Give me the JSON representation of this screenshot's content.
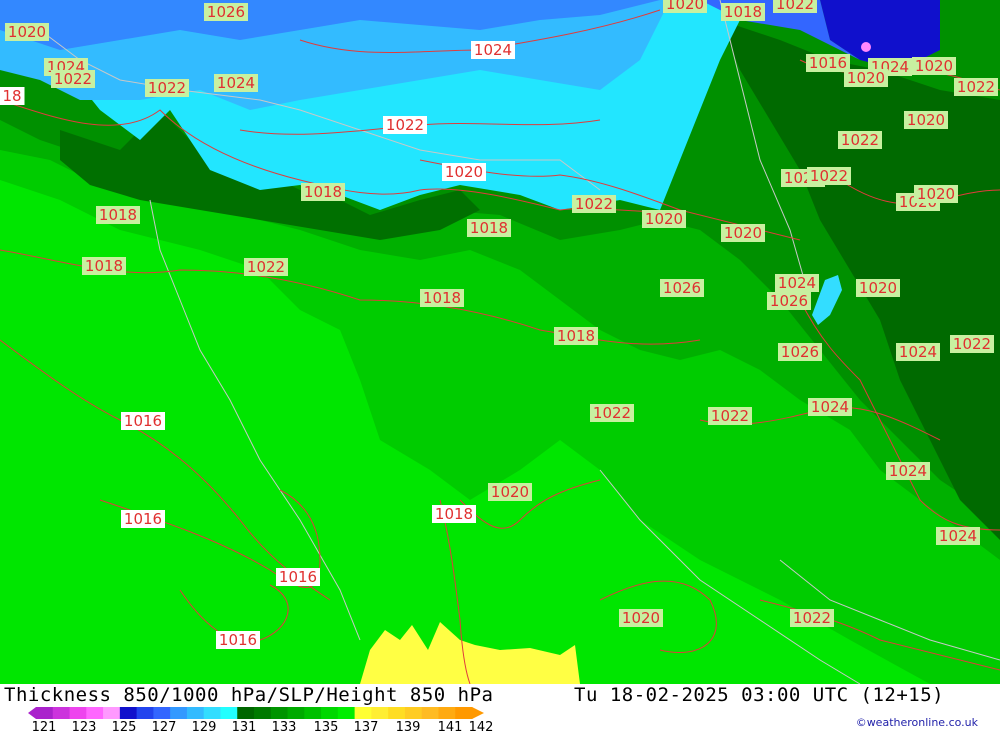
{
  "map": {
    "isobar_labels": [
      {
        "text": "1026",
        "style": "green"
      },
      {
        "text": "1020",
        "style": "green"
      },
      {
        "text": "1024",
        "style": "green"
      },
      {
        "text": "1022",
        "style": "green"
      },
      {
        "text": "18",
        "style": "pink"
      },
      {
        "text": "1022",
        "style": "green"
      },
      {
        "text": "1024",
        "style": "green"
      },
      {
        "text": "1024",
        "style": "pink"
      },
      {
        "text": "1022",
        "style": "pink"
      },
      {
        "text": "1020",
        "style": "pink"
      },
      {
        "text": "1018",
        "style": "green"
      },
      {
        "text": "1022",
        "style": "green"
      },
      {
        "text": "1020",
        "style": "green"
      },
      {
        "text": "1016",
        "style": "green"
      },
      {
        "text": "1024",
        "style": "green"
      },
      {
        "text": "1020",
        "style": "green"
      },
      {
        "text": "1020",
        "style": "green"
      },
      {
        "text": "1022",
        "style": "green"
      },
      {
        "text": "1020",
        "style": "green"
      },
      {
        "text": "1022",
        "style": "green"
      },
      {
        "text": "1020",
        "style": "green"
      },
      {
        "text": "1022",
        "style": "green"
      },
      {
        "text": "1020",
        "style": "green"
      },
      {
        "text": "1020",
        "style": "green"
      },
      {
        "text": "1022",
        "style": "green"
      },
      {
        "text": "1020",
        "style": "green"
      },
      {
        "text": "1018",
        "style": "green"
      },
      {
        "text": "1020",
        "style": "green"
      },
      {
        "text": "1018",
        "style": "green"
      },
      {
        "text": "1018",
        "style": "green"
      },
      {
        "text": "1018",
        "style": "green"
      },
      {
        "text": "1022",
        "style": "green"
      },
      {
        "text": "1026",
        "style": "green"
      },
      {
        "text": "1024",
        "style": "green"
      },
      {
        "text": "1026",
        "style": "green"
      },
      {
        "text": "1018",
        "style": "green"
      },
      {
        "text": "1020",
        "style": "green"
      },
      {
        "text": "1018",
        "style": "green"
      },
      {
        "text": "1026",
        "style": "green"
      },
      {
        "text": "1024",
        "style": "green"
      },
      {
        "text": "1022",
        "style": "green"
      },
      {
        "text": "1016",
        "style": "pink"
      },
      {
        "text": "1022",
        "style": "green"
      },
      {
        "text": "1022",
        "style": "green"
      },
      {
        "text": "1024",
        "style": "green"
      },
      {
        "text": "1024",
        "style": "green"
      },
      {
        "text": "1020",
        "style": "green"
      },
      {
        "text": "1018",
        "style": "pink"
      },
      {
        "text": "1016",
        "style": "pink"
      },
      {
        "text": "1024",
        "style": "green"
      },
      {
        "text": "1016",
        "style": "pink"
      },
      {
        "text": "1020",
        "style": "green"
      },
      {
        "text": "1022",
        "style": "green"
      },
      {
        "text": "1016",
        "style": "pink"
      }
    ]
  },
  "footer": {
    "title_left": "Thickness 850/1000 hPa/SLP/Height 850 hPa",
    "title_right": "Tu 18-02-2025 03:00 UTC (12+15)",
    "credit": "©weatheronline.co.uk"
  },
  "legend": {
    "colors": [
      "#aa22cc",
      "#cc33dd",
      "#ee44ee",
      "#ff66ff",
      "#ff99ff",
      "#1010cc",
      "#2244ee",
      "#3366ff",
      "#3399ff",
      "#33bbff",
      "#33ddff",
      "#22ffff",
      "#006600",
      "#007a00",
      "#009400",
      "#00aa00",
      "#00c000",
      "#00d800",
      "#00ee00",
      "#ffff33",
      "#ffee33",
      "#ffdd22",
      "#ffcc22",
      "#ffbb22",
      "#ffaa11",
      "#ff9900"
    ],
    "tick_labels": [
      "121",
      "123",
      "125",
      "127",
      "129",
      "131",
      "133",
      "135",
      "137",
      "139",
      "141",
      "142"
    ]
  },
  "colors": {
    "contour": "#e03c3c",
    "border": "#c8c8c8",
    "label_green_bg": "#c8f0a0",
    "label_pink_bg": "#ffffff",
    "label_text": "#e03030"
  }
}
